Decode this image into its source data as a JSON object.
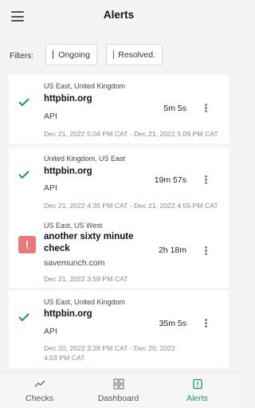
{
  "header": {
    "title": "Alerts",
    "menu_icon": "hamburger-menu-icon"
  },
  "filters": {
    "label": "Filters:",
    "chips": [
      {
        "label": "Ongoing",
        "color": "#8b1e2b"
      },
      {
        "label": "Resolved.",
        "color": "#1a9a5a"
      }
    ]
  },
  "alerts": [
    {
      "status": "resolved",
      "status_icon": "check-icon",
      "region": "US East, United Kingdom",
      "host": "httpbin.org",
      "service": "API",
      "duration": "5m 5s",
      "time": "Dec 21, 2022 5:04 PM CAT - Dec 21, 2022 5:09 PM CAT"
    },
    {
      "status": "resolved",
      "status_icon": "check-icon",
      "region": "United Kingdom, US East",
      "host": "httpbin.org",
      "service": "API",
      "duration": "19m 57s",
      "time": "Dec 21, 2022 4:35 PM CAT - Dec 21, 2022 4:55 PM CAT"
    },
    {
      "status": "ongoing",
      "status_icon": "alert-icon",
      "alert_glyph": "!",
      "region": "US East, US West",
      "host": "another sixty minute check",
      "service": "savemunch.com",
      "duration": "2h 18m",
      "time": "Dec 21, 2022 3:59 PM CAT"
    },
    {
      "status": "resolved",
      "status_icon": "check-icon",
      "region": "US East, United Kingdom",
      "host": "httpbin.org",
      "service": "API",
      "duration": "35m 5s",
      "time": "Dec 20, 2022 3:28 PM CAT - Dec 20, 2022 4:03 PM CAT"
    }
  ],
  "nav": [
    {
      "label": "Checks",
      "icon": "chart-line-icon"
    },
    {
      "label": "Dashboard",
      "icon": "dashboard-grid-icon"
    },
    {
      "label": "Alerts",
      "icon": "alert-square-icon",
      "active": true
    }
  ],
  "colors": {
    "accent": "#1a9a5a",
    "alert": "#e87a7a",
    "ongoing": "#8b1e2b"
  }
}
